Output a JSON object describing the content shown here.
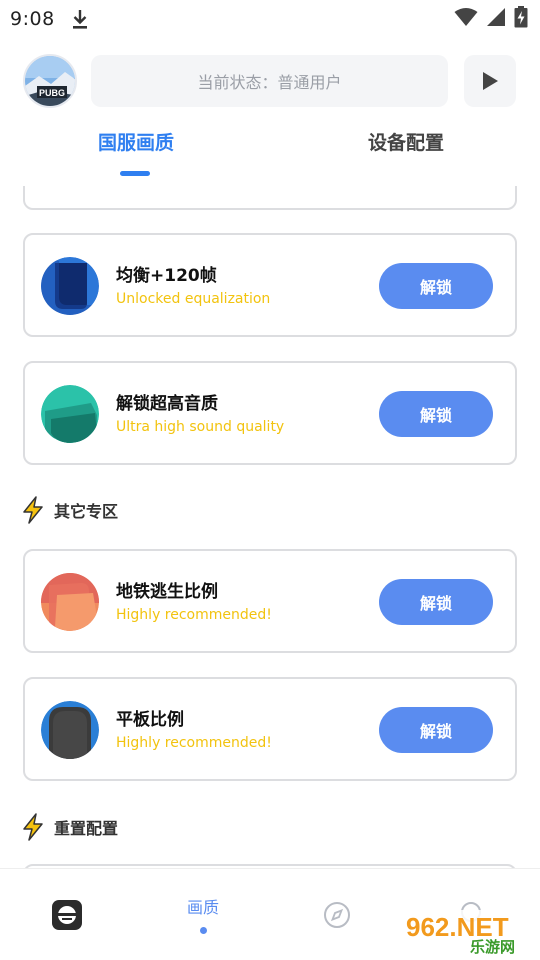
{
  "status_bar": {
    "time": "9:08"
  },
  "header": {
    "status_text": "当前状态：普通用户",
    "avatar_text": "PUBG"
  },
  "tabs": [
    {
      "label": "国服画质",
      "active": true
    },
    {
      "label": "设备配置",
      "active": false
    }
  ],
  "cards": [
    {
      "title": "均衡+120帧",
      "subtitle": "Unlocked equalization",
      "button": "解锁",
      "icon": "blue-phone-icon"
    },
    {
      "title": "解锁超高音质",
      "subtitle": "Ultra high sound quality",
      "button": "解锁",
      "icon": "teal-layers-icon"
    }
  ],
  "sections": [
    {
      "label": "其它专区",
      "icon": "lightning-icon",
      "cards": [
        {
          "title": "地铁逃生比例",
          "subtitle": "Highly recommended!",
          "button": "解锁",
          "icon": "orange-layers-icon"
        },
        {
          "title": "平板比例",
          "subtitle": "Highly recommended!",
          "button": "解锁",
          "icon": "dark-tablet-icon"
        }
      ]
    },
    {
      "label": "重置配置",
      "icon": "lightning-icon"
    }
  ],
  "bottom_nav": {
    "active_label": "画质"
  },
  "watermark": {
    "text_top": "962.NET",
    "text_bottom": "乐游网"
  },
  "colors": {
    "accent": "#2f7ff0",
    "button": "#5a8cf0",
    "subtitle": "#f2c30f"
  }
}
